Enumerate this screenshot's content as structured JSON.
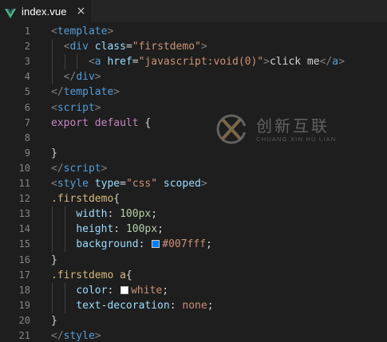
{
  "tab": {
    "label": "index.vue",
    "close_glyph": "×",
    "icon": "vue-icon"
  },
  "editor": {
    "line_numbers": [
      "1",
      "2",
      "3",
      "4",
      "5",
      "6",
      "7",
      "8",
      "9",
      "10",
      "11",
      "12",
      "13",
      "14",
      "15",
      "16",
      "17",
      "18",
      "19",
      "20",
      "21"
    ],
    "lines": [
      [
        [
          "t-punc",
          "<"
        ],
        [
          "t-tag",
          "template"
        ],
        [
          "t-punc",
          ">"
        ]
      ],
      [
        [
          "t-punc",
          "  <"
        ],
        [
          "t-tag",
          "div"
        ],
        [
          "t-text",
          " "
        ],
        [
          "t-attr",
          "class"
        ],
        [
          "t-text",
          "="
        ],
        [
          "t-str",
          "\"firstdemo\""
        ],
        [
          "t-punc",
          ">"
        ]
      ],
      [
        [
          "t-punc",
          "      <"
        ],
        [
          "t-tag",
          "a"
        ],
        [
          "t-text",
          " "
        ],
        [
          "t-attr",
          "href"
        ],
        [
          "t-text",
          "="
        ],
        [
          "t-str",
          "\"javascript:void(0)\""
        ],
        [
          "t-punc",
          ">"
        ],
        [
          "t-text",
          "click me"
        ],
        [
          "t-punc",
          "</"
        ],
        [
          "t-tag",
          "a"
        ],
        [
          "t-punc",
          ">"
        ]
      ],
      [
        [
          "t-punc",
          "  </"
        ],
        [
          "t-tag",
          "div"
        ],
        [
          "t-punc",
          ">"
        ]
      ],
      [
        [
          "t-punc",
          "</"
        ],
        [
          "t-tag",
          "template"
        ],
        [
          "t-punc",
          ">"
        ]
      ],
      [
        [
          "t-punc",
          "<"
        ],
        [
          "t-tag",
          "script"
        ],
        [
          "t-punc",
          ">"
        ]
      ],
      [
        [
          "t-kw",
          "export"
        ],
        [
          "t-text",
          " "
        ],
        [
          "t-kw",
          "default"
        ],
        [
          "t-text",
          " {"
        ]
      ],
      [],
      [
        [
          "t-text",
          "}"
        ]
      ],
      [
        [
          "t-punc",
          "</"
        ],
        [
          "t-tag",
          "script"
        ],
        [
          "t-punc",
          ">"
        ]
      ],
      [
        [
          "t-punc",
          "<"
        ],
        [
          "t-tag",
          "style"
        ],
        [
          "t-text",
          " "
        ],
        [
          "t-attr",
          "type"
        ],
        [
          "t-text",
          "="
        ],
        [
          "t-str",
          "\"css\""
        ],
        [
          "t-text",
          " "
        ],
        [
          "t-attr",
          "scoped"
        ],
        [
          "t-punc",
          ">"
        ]
      ],
      [
        [
          "t-sel",
          ".firstdemo"
        ],
        [
          "t-text",
          "{"
        ]
      ],
      [
        [
          "t-text",
          "    "
        ],
        [
          "t-attr",
          "width"
        ],
        [
          "t-text",
          ": "
        ],
        [
          "t-num",
          "100px"
        ],
        [
          "t-text",
          ";"
        ]
      ],
      [
        [
          "t-text",
          "    "
        ],
        [
          "t-attr",
          "height"
        ],
        [
          "t-text",
          ": "
        ],
        [
          "t-num",
          "100px"
        ],
        [
          "t-text",
          ";"
        ]
      ],
      [
        [
          "t-text",
          "    "
        ],
        [
          "t-attr",
          "background"
        ],
        [
          "t-text",
          ": "
        ],
        [
          "swatch",
          "#007fff"
        ],
        [
          "t-val",
          "#007fff"
        ],
        [
          "t-text",
          ";"
        ]
      ],
      [
        [
          "t-text",
          "}"
        ]
      ],
      [
        [
          "t-sel",
          ".firstdemo a"
        ],
        [
          "t-text",
          "{"
        ]
      ],
      [
        [
          "t-text",
          "    "
        ],
        [
          "t-attr",
          "color"
        ],
        [
          "t-text",
          ": "
        ],
        [
          "swatch",
          "#ffffff"
        ],
        [
          "t-val",
          "white"
        ],
        [
          "t-text",
          ";"
        ]
      ],
      [
        [
          "t-text",
          "    "
        ],
        [
          "t-attr",
          "text-decoration"
        ],
        [
          "t-text",
          ": "
        ],
        [
          "t-val",
          "none"
        ],
        [
          "t-text",
          ";"
        ]
      ],
      [
        [
          "t-text",
          "}"
        ]
      ],
      [
        [
          "t-punc",
          "</"
        ],
        [
          "t-tag",
          "style"
        ],
        [
          "t-punc",
          ">"
        ]
      ]
    ]
  },
  "watermark": {
    "title": "创新互联",
    "subtitle": "CHUANG XIN HU LIAN"
  },
  "colors": {
    "background": "#1e1e1e",
    "tab_bar": "#252526",
    "line_number": "#858585",
    "tag": "#569cd6",
    "attribute": "#9cdcfe",
    "string": "#ce9178",
    "keyword": "#c586c0",
    "selector": "#d7ba7d",
    "number": "#b5cea8"
  }
}
